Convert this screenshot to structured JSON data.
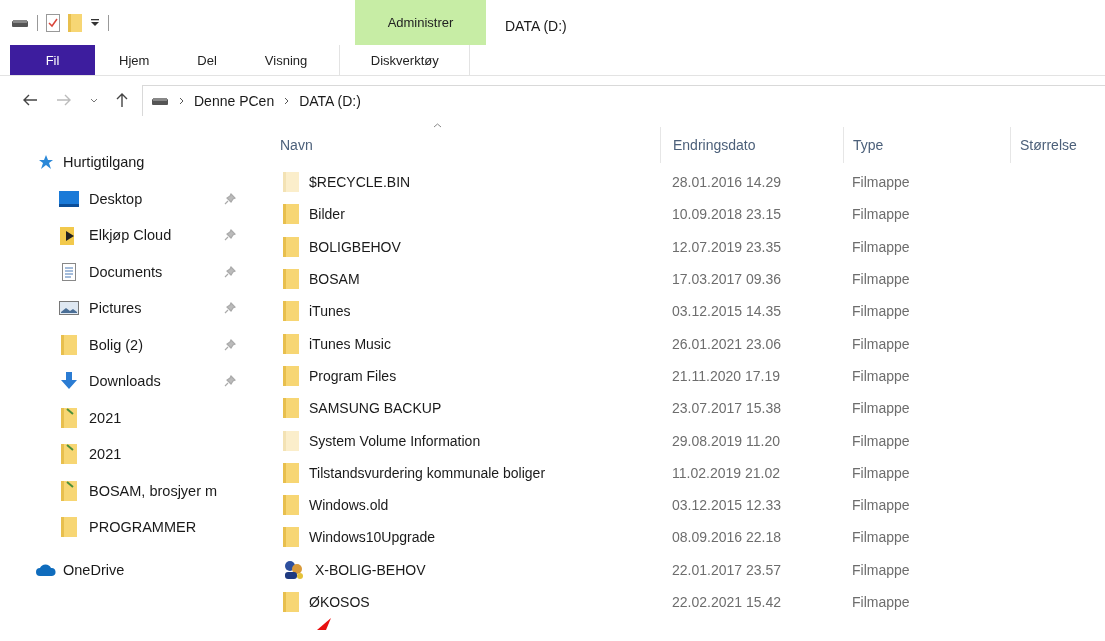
{
  "window": {
    "title": "DATA (D:)"
  },
  "ribbon": {
    "context_group": "Administrer",
    "tabs": [
      {
        "label": "Fil",
        "kind": "file",
        "selected": false
      },
      {
        "label": "Hjem",
        "kind": "tab",
        "selected": false
      },
      {
        "label": "Del",
        "kind": "tab",
        "selected": false
      },
      {
        "label": "Visning",
        "kind": "tab",
        "selected": false
      },
      {
        "label": "Diskverktøy",
        "kind": "context",
        "selected": false
      }
    ]
  },
  "address": {
    "path": [
      "Denne PCen",
      "DATA (D:)"
    ]
  },
  "sidebar": {
    "items": [
      {
        "label": "Hurtigtilgang",
        "kind": "star",
        "children": [
          {
            "label": "Desktop",
            "kind": "desktop",
            "pinned": true
          },
          {
            "label": "Elkjøp Cloud",
            "kind": "cloud-folder",
            "pinned": true
          },
          {
            "label": "Documents",
            "kind": "documents",
            "pinned": true
          },
          {
            "label": "Pictures",
            "kind": "pictures",
            "pinned": true
          },
          {
            "label": "Bolig (2)",
            "kind": "folder",
            "pinned": true
          },
          {
            "label": "Downloads",
            "kind": "downloads",
            "pinned": true
          },
          {
            "label": "2021",
            "kind": "shortcut-folder",
            "pinned": false
          },
          {
            "label": "2021",
            "kind": "shortcut-folder",
            "pinned": false
          },
          {
            "label": "BOSAM, brosjyer m",
            "kind": "shortcut-folder",
            "pinned": false
          },
          {
            "label": "PROGRAMMER",
            "kind": "folder",
            "pinned": false
          }
        ]
      },
      {
        "label": "OneDrive",
        "kind": "onedrive"
      }
    ]
  },
  "table": {
    "columns": [
      "Navn",
      "Endringsdato",
      "Type",
      "Størrelse"
    ],
    "rows": [
      {
        "name": "$RECYCLE.BIN",
        "date": "28.01.2016 14.29",
        "type": "Filmappe",
        "kind": "hidden-folder"
      },
      {
        "name": "Bilder",
        "date": "10.09.2018 23.15",
        "type": "Filmappe",
        "kind": "folder"
      },
      {
        "name": "BOLIGBEHOV",
        "date": "12.07.2019 23.35",
        "type": "Filmappe",
        "kind": "folder"
      },
      {
        "name": "BOSAM",
        "date": "17.03.2017 09.36",
        "type": "Filmappe",
        "kind": "folder"
      },
      {
        "name": "iTunes",
        "date": "03.12.2015 14.35",
        "type": "Filmappe",
        "kind": "folder"
      },
      {
        "name": "iTunes Music",
        "date": "26.01.2021 23.06",
        "type": "Filmappe",
        "kind": "folder"
      },
      {
        "name": "Program Files",
        "date": "21.11.2020 17.19",
        "type": "Filmappe",
        "kind": "folder"
      },
      {
        "name": "SAMSUNG BACKUP",
        "date": "23.07.2017 15.38",
        "type": "Filmappe",
        "kind": "folder"
      },
      {
        "name": "System Volume Information",
        "date": "29.08.2019 11.20",
        "type": "Filmappe",
        "kind": "hidden-folder"
      },
      {
        "name": "Tilstandsvurdering kommunale boliger",
        "date": "11.02.2019 21.02",
        "type": "Filmappe",
        "kind": "folder"
      },
      {
        "name": "Windows.old",
        "date": "03.12.2015 12.33",
        "type": "Filmappe",
        "kind": "folder"
      },
      {
        "name": "Windows10Upgrade",
        "date": "08.09.2016 22.18",
        "type": "Filmappe",
        "kind": "folder"
      },
      {
        "name": "X-BOLIG-BEHOV",
        "date": "22.01.2017 23.57",
        "type": "Filmappe",
        "kind": "app-folder"
      },
      {
        "name": "ØKOSOS",
        "date": "22.02.2021 15.42",
        "type": "Filmappe",
        "kind": "folder"
      }
    ]
  }
}
